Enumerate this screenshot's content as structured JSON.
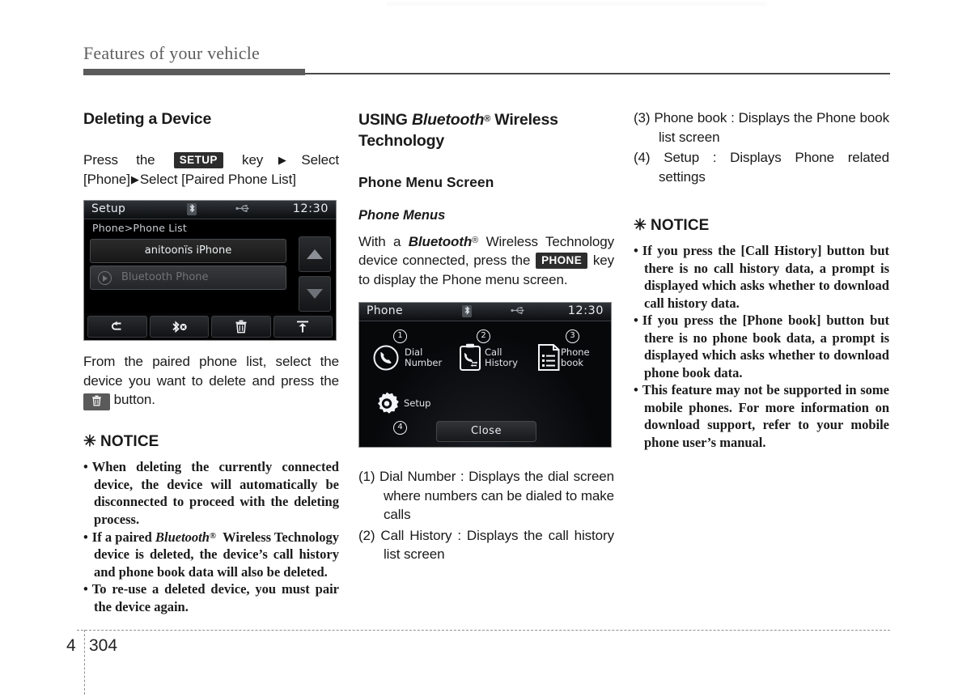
{
  "header": {
    "title": "Features of your vehicle"
  },
  "footer": {
    "chapter": "4",
    "page": "304"
  },
  "column1": {
    "section_title": "Deleting a Device",
    "instruction": {
      "part1": "Press   the",
      "key": "SETUP",
      "part2": "key",
      "arrow": "▶",
      "part3": "Select",
      "part4": "[Phone]",
      "part5": "Select [Paired Phone List]"
    },
    "device_screen": {
      "title": "Setup",
      "clock": "12:30",
      "bluetooth_icon": "bluetooth-icon",
      "usb_icon": "usb-icon",
      "breadcrumb": "Phone>Phone List",
      "rows": [
        {
          "label": "anitoonïs iPhone",
          "state": "selected"
        },
        {
          "label": "Bluetooth Phone",
          "state": "disabled"
        }
      ],
      "scroll_up": "▲",
      "scroll_down": "▼",
      "toolbar": [
        {
          "name": "back-icon",
          "glyph": "↩"
        },
        {
          "name": "bluetooth-off-icon",
          "glyph": "✶"
        },
        {
          "name": "delete-icon",
          "glyph": "🗑"
        },
        {
          "name": "upload-icon",
          "glyph": "⤒"
        }
      ]
    },
    "paragraph": {
      "part1": "From the paired phone list, select the device you want to delete and press the",
      "icon": "delete-icon",
      "part2": "button."
    },
    "notice": {
      "asterisk": "✳",
      "heading": "NOTICE",
      "items": [
        "When deleting the currently connected device, the device will automatically be disconnected to proceed with the deleting process.",
        "If a paired Bluetooth® Wireless Technology device is deleted, the device’s call history and phone book data will also be deleted.",
        "To re-use a deleted device, you must pair the device again."
      ]
    }
  },
  "column2": {
    "section_title_prefix": "USING ",
    "section_title_brand": "Bluetooth",
    "section_title_reg": "®",
    "section_title_suffix": " Wireless Technology",
    "sub_title": "Phone Menu Screen",
    "italic_title": "Phone Menus",
    "paragraph": {
      "part1": "With   a",
      "brand": "Bluetooth",
      "reg": "®",
      "part2": "Wireless Technology device connected, press the",
      "key": "PHONE",
      "part3": "key to display the Phone menu screen."
    },
    "device_screen": {
      "title": "Phone",
      "clock": "12:30",
      "bluetooth_icon": "bluetooth-icon",
      "usb_icon": "usb-icon",
      "items": [
        {
          "badge": "①",
          "label": "Dial\nNumber",
          "icon": "dial-number-icon"
        },
        {
          "badge": "②",
          "label": "Call\nHistory",
          "icon": "call-history-icon"
        },
        {
          "badge": "③",
          "label": "Phone\nbook",
          "icon": "phone-book-icon"
        },
        {
          "badge": "④",
          "label": "Setup",
          "icon": "setup-gear-icon"
        }
      ],
      "close_label": "Close"
    },
    "descriptions": [
      {
        "num": "(1)",
        "text": "Dial Number : Displays the dial screen where numbers can be dialed to make calls"
      },
      {
        "num": "(2)",
        "text": "Call History : Displays the call history list screen"
      }
    ]
  },
  "column3": {
    "descriptions": [
      {
        "num": "(3)",
        "text": "Phone book : Displays the Phone book list screen"
      },
      {
        "num": "(4)",
        "text": "Setup : Displays Phone related settings"
      }
    ],
    "notice": {
      "asterisk": "✳",
      "heading": "NOTICE",
      "items": [
        "If you press the [Call History] button but there is no call history data, a prompt is displayed which asks whether to download call history data.",
        "If you press the [Phone book] button but there is no phone book data, a prompt is displayed which asks whether to download phone book data.",
        "This feature may not be supported in some mobile phones. For more information on download support, refer to your mobile phone user’s manual."
      ]
    }
  }
}
